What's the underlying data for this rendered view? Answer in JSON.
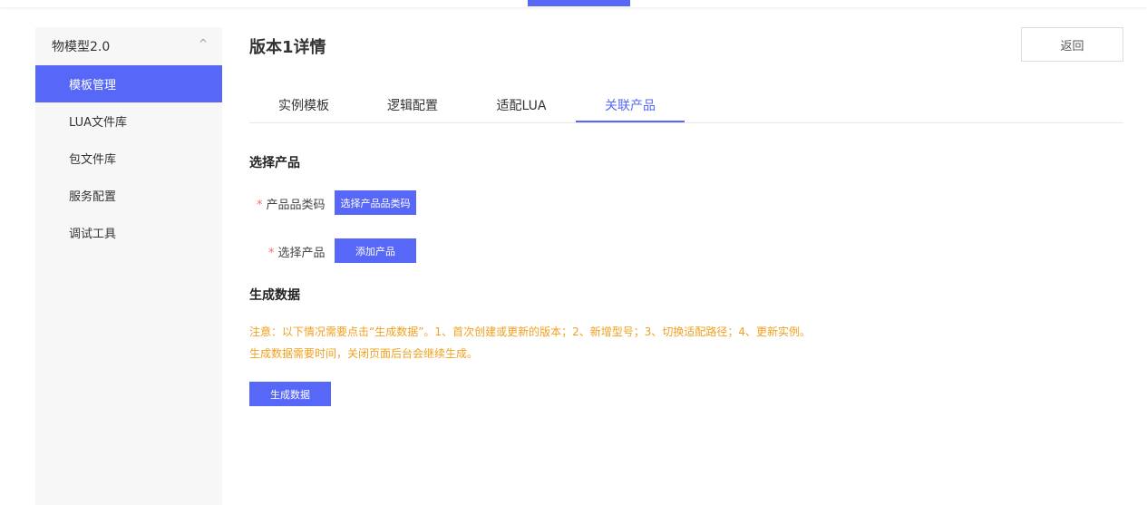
{
  "sidebar": {
    "group_label": "物模型2.0",
    "items": [
      {
        "label": "模板管理"
      },
      {
        "label": "LUA文件库"
      },
      {
        "label": "包文件库"
      },
      {
        "label": "服务配置"
      },
      {
        "label": "调试工具"
      }
    ]
  },
  "header": {
    "title": "版本1详情",
    "back_label": "返回"
  },
  "tabs": [
    {
      "label": "实例模板"
    },
    {
      "label": "逻辑配置"
    },
    {
      "label": "适配LUA"
    },
    {
      "label": "关联产品"
    }
  ],
  "select_product": {
    "section_title": "选择产品",
    "category_label": "产品品类码",
    "category_button": "选择产品品类码",
    "product_label": "选择产品",
    "product_button": "添加产品"
  },
  "generate": {
    "section_title": "生成数据",
    "notice_line1": "注意：以下情况需要点击“生成数据”。1、首次创建或更新的版本；2、新增型号；3、切换适配路径；4、更新实例。",
    "notice_line2": "生成数据需要时间，关闭页面后台会继续生成。",
    "button_label": "生成数据"
  },
  "colors": {
    "accent": "#5767f7",
    "notice": "#f0a020",
    "required": "#f56c6c"
  },
  "icons": {
    "sidebar_group_toggle": "chevron-up-icon"
  },
  "ui": {
    "required_mark": "*",
    "chevron_glyph": "^"
  }
}
